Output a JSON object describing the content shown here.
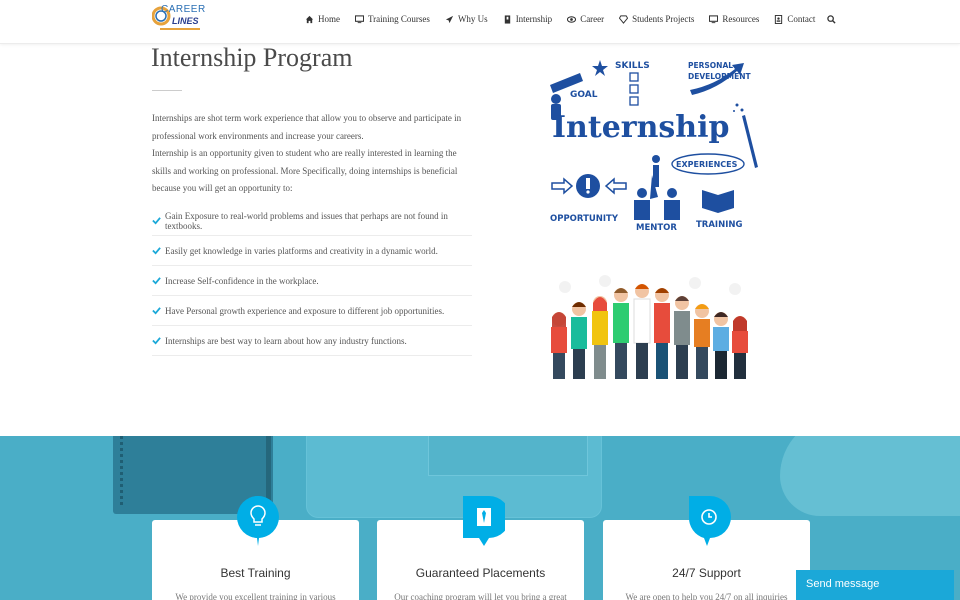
{
  "header": {
    "logo": {
      "line1": "CAREER",
      "line2": "LINES"
    },
    "nav": [
      {
        "label": "Home",
        "icon": "home-icon"
      },
      {
        "label": "Training Courses",
        "icon": "monitor-icon"
      },
      {
        "label": "Why Us",
        "icon": "send-icon"
      },
      {
        "label": "Internship",
        "icon": "id-badge-icon"
      },
      {
        "label": "Career",
        "icon": "eye-icon"
      },
      {
        "label": "Students Projects",
        "icon": "diamond-icon"
      },
      {
        "label": "Resources",
        "icon": "monitor-icon"
      },
      {
        "label": "Contact",
        "icon": "contact-icon"
      }
    ],
    "search_icon": "search-icon"
  },
  "main": {
    "title": "Internship Program",
    "intro": [
      "Internships are shot term work experience that allow you to observe and participate in professional work environments and increase your careers.",
      "Internship is an opportunity given to student who are really interested in learning the skills and working on professional. More Specifically, doing internships is beneficial because you will get an opportunity to:"
    ],
    "bullets": [
      "Gain Exposure to real-world problems and issues that perhaps are not found in textbooks.",
      "Easily get knowledge in varies platforms and creativity in a dynamic world.",
      "Increase Self-confidence in the workplace.",
      "Have Personal growth experience and exposure to different job opportunities.",
      "Internships are best way to learn about how any industry functions."
    ]
  },
  "illustration": {
    "big": "Internship",
    "goal": "GOAL",
    "skills": "SKILLS",
    "personal": "PERSONAL",
    "development": "DEVELOPMENT",
    "experiences": "EXPERIENCES",
    "opportunity": "OPPORTUNITY",
    "mentor": "MENTOR",
    "training": "TRAINING"
  },
  "features": [
    {
      "title": "Best Training",
      "text": "We provide you excellent training in various",
      "icon": "lightbulb-icon"
    },
    {
      "title": "Guaranteed Placements",
      "text": "Our coaching program will let you bring a great",
      "icon": "tie-icon"
    },
    {
      "title": "24/7 Support",
      "text": "We are open to help you 24/7 on all inquiries",
      "icon": "clock-icon"
    }
  ],
  "chat": {
    "label": "Send message"
  },
  "colors": {
    "accent": "#00aee6",
    "banner": "#4aaec7",
    "illustration": "#1e4fa0"
  }
}
